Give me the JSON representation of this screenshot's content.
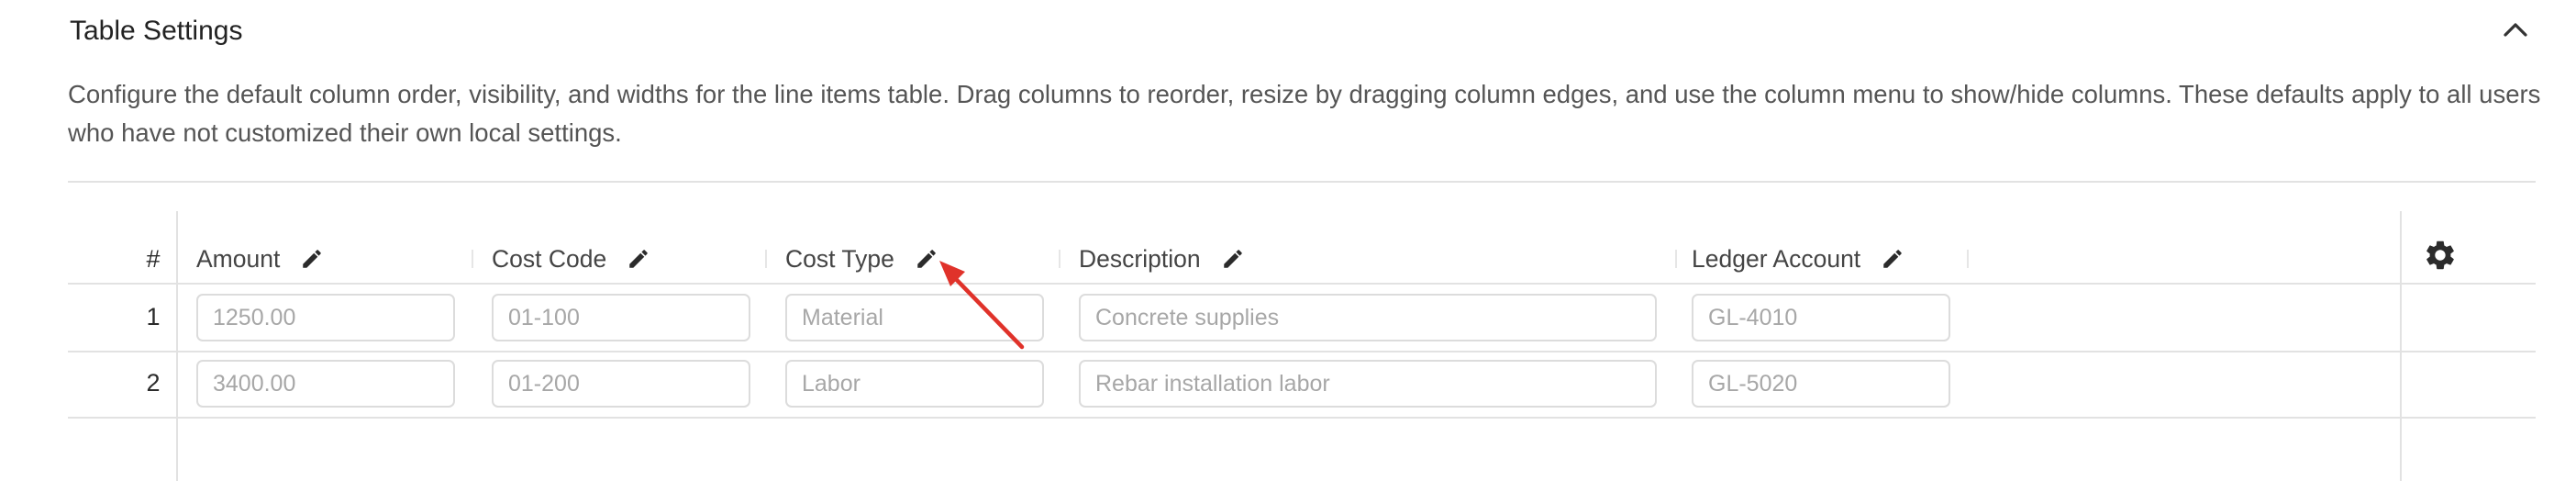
{
  "section": {
    "title": "Table Settings",
    "description": "Configure the default column order, visibility, and widths for the line items table. Drag columns to reorder, resize by dragging column edges, and use the column menu to show/hide columns. These defaults apply to all users who have not customized their own local settings."
  },
  "table": {
    "hash_header": "#",
    "columns": [
      {
        "label": "Amount"
      },
      {
        "label": "Cost Code"
      },
      {
        "label": "Cost Type"
      },
      {
        "label": "Description"
      },
      {
        "label": "Ledger Account"
      }
    ],
    "rows": [
      {
        "num": "1",
        "amount": "1250.00",
        "cost_code": "01-100",
        "cost_type": "Material",
        "description": "Concrete supplies",
        "ledger": "GL-4010"
      },
      {
        "num": "2",
        "amount": "3400.00",
        "cost_code": "01-200",
        "cost_type": "Labor",
        "description": "Rebar installation labor",
        "ledger": "GL-5020"
      }
    ]
  },
  "icons": {
    "collapse": "chevron-up-icon",
    "edit": "pencil-icon",
    "settings": "gear-icon",
    "annotation": "red-arrow"
  },
  "colors": {
    "annotation_arrow": "#e0322a",
    "border": "#e2e2e2",
    "icon": "#2b2b2b"
  }
}
